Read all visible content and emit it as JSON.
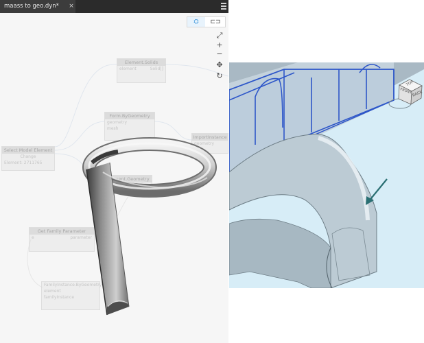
{
  "tab": {
    "title": "maass to geo.dyn*",
    "close": "×"
  },
  "view_toggle": {
    "geometry_icon": "geometry-view-icon",
    "graph_icon": "graph-view-icon"
  },
  "nav": {
    "fit": "⤢",
    "zoom_in": "+",
    "zoom_out": "−",
    "pan": "✥",
    "orbit": "↻"
  },
  "nodes": {
    "element_solids": {
      "title": "Element.Solids",
      "in": "element",
      "out": "Solid[]"
    },
    "form_by_geometry": {
      "title": "Form.ByGeometry",
      "rows": [
        "geometry",
        "mesh"
      ]
    },
    "select_model_element": {
      "title": "Select Model Element",
      "button": "Change",
      "value": "Element: 2711765"
    },
    "import_instance": {
      "title": "ImportInstance",
      "rows": [
        "geometry"
      ]
    },
    "element_geometry": {
      "title": "Element.Geometry",
      "rows": [
        "element"
      ]
    },
    "get_family_parameter": {
      "title": "Get Family Parameter",
      "rows": [
        "e",
        "parameter"
      ]
    },
    "bottom_node": {
      "rows": [
        "FamilyInstance.ByGeometry",
        "element",
        "familyInstance"
      ]
    }
  },
  "revit": {
    "viewcube": {
      "top": "TOP",
      "left": "FRONT",
      "right": "BACK"
    }
  },
  "colors": {
    "pipe": "#7f7f7f",
    "revit_bg": "#d7edf7",
    "blue_frame": "#2d56c9",
    "arrow": "#2a6f73"
  }
}
